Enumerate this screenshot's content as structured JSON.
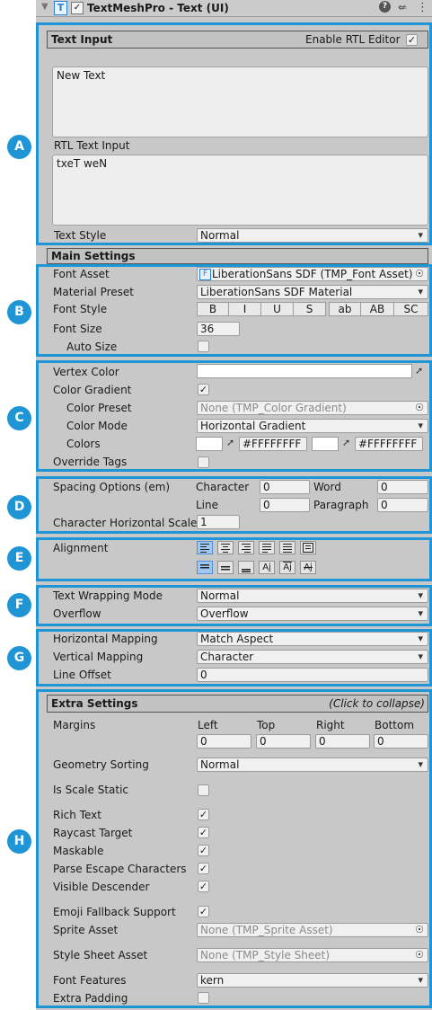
{
  "header": {
    "title": "TextMeshPro - Text (UI)"
  },
  "badges": {
    "a": "A",
    "b": "B",
    "c": "C",
    "d": "D",
    "e": "E",
    "f": "F",
    "g": "G",
    "h": "H"
  },
  "text_input": {
    "section_label": "Text Input",
    "rtl_label": "Enable RTL Editor",
    "text_value": "New Text",
    "rtl_input_label": "RTL Text Input",
    "rtl_value": "txeT weN",
    "text_style_label": "Text Style",
    "text_style_value": "Normal"
  },
  "main_settings": {
    "section_label": "Main Settings",
    "font_asset_label": "Font Asset",
    "font_asset_value": "LiberationSans SDF (TMP_Font Asset)",
    "material_preset_label": "Material Preset",
    "material_preset_value": "LiberationSans SDF Material",
    "font_style_label": "Font Style",
    "font_style_buttons": [
      "B",
      "I",
      "U",
      "S",
      "ab",
      "AB",
      "SC"
    ],
    "font_size_label": "Font Size",
    "font_size_value": "36",
    "auto_size_label": "Auto Size"
  },
  "color": {
    "vertex_color_label": "Vertex Color",
    "color_gradient_label": "Color Gradient",
    "color_preset_label": "Color Preset",
    "color_preset_value": "None (TMP_Color Gradient)",
    "color_mode_label": "Color Mode",
    "color_mode_value": "Horizontal Gradient",
    "colors_label": "Colors",
    "color1_hex": "#FFFFFFFF",
    "color2_hex": "#FFFFFFFF",
    "override_tags_label": "Override Tags"
  },
  "spacing": {
    "label": "Spacing Options (em)",
    "character_label": "Character",
    "character_value": "0",
    "word_label": "Word",
    "word_value": "0",
    "line_label": "Line",
    "line_value": "0",
    "paragraph_label": "Paragraph",
    "paragraph_value": "0",
    "char_h_scale_label": "Character Horizontal Scale",
    "char_h_scale_value": "1"
  },
  "alignment": {
    "label": "Alignment"
  },
  "wrapping": {
    "wrap_label": "Text Wrapping Mode",
    "wrap_value": "Normal",
    "overflow_label": "Overflow",
    "overflow_value": "Overflow"
  },
  "mapping": {
    "h_label": "Horizontal Mapping",
    "h_value": "Match Aspect",
    "v_label": "Vertical Mapping",
    "v_value": "Character",
    "line_offset_label": "Line Offset",
    "line_offset_value": "0"
  },
  "extra": {
    "section_label": "Extra Settings",
    "collapse_hint": "(Click to collapse)",
    "margins_label": "Margins",
    "margin_left_label": "Left",
    "margin_left": "0",
    "margin_top_label": "Top",
    "margin_top": "0",
    "margin_right_label": "Right",
    "margin_right": "0",
    "margin_bottom_label": "Bottom",
    "margin_bottom": "0",
    "geometry_sorting_label": "Geometry Sorting",
    "geometry_sorting_value": "Normal",
    "is_scale_static_label": "Is Scale Static",
    "rich_text_label": "Rich Text",
    "raycast_label": "Raycast Target",
    "maskable_label": "Maskable",
    "parse_escape_label": "Parse Escape Characters",
    "visible_descender_label": "Visible Descender",
    "emoji_label": "Emoji Fallback Support",
    "sprite_asset_label": "Sprite Asset",
    "sprite_asset_value": "None (TMP_Sprite Asset)",
    "style_sheet_label": "Style Sheet Asset",
    "style_sheet_value": "None (TMP_Style Sheet)",
    "font_features_label": "Font Features",
    "font_features_value": "kern",
    "extra_padding_label": "Extra Padding"
  },
  "colors": {
    "accent": "#1f95d6",
    "panel": "#c8c8c8",
    "field": "#f0f0f0",
    "selected": "#9ec7f4"
  }
}
